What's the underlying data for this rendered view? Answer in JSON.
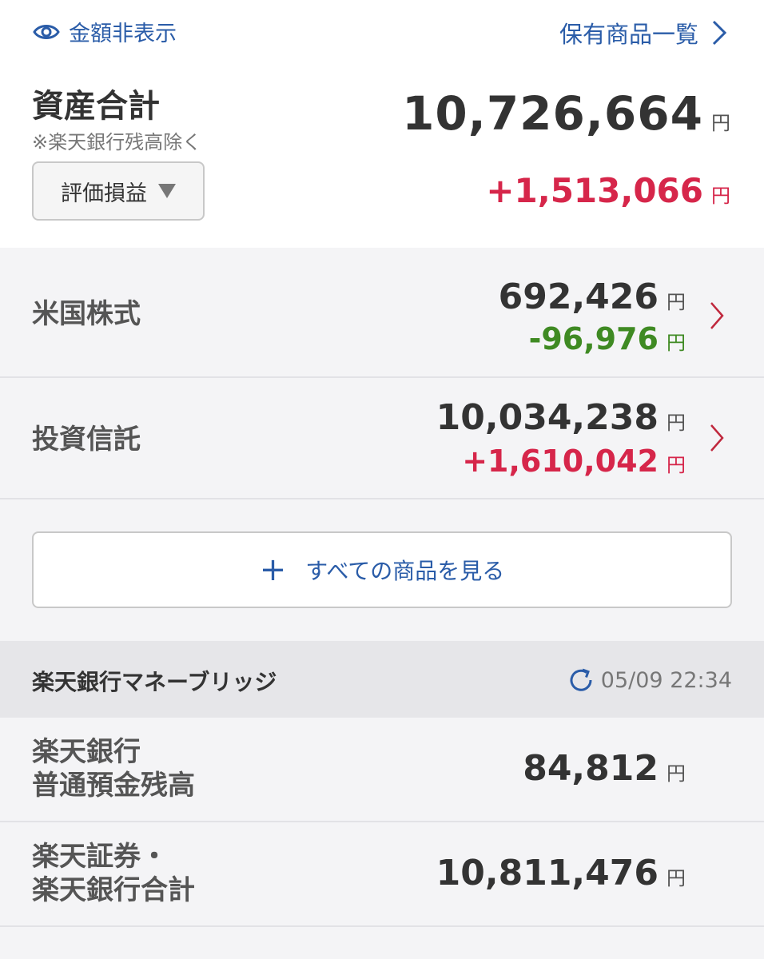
{
  "header": {
    "hide_amounts": "金額非表示",
    "holdings_list": "保有商品一覧"
  },
  "summary": {
    "title": "資産合計",
    "note": "※楽天銀行残高除く",
    "total": "10,726,664",
    "currency": "円",
    "pl_selector": "評価損益",
    "total_gain": "+1,513,066"
  },
  "holdings": [
    {
      "label": "米国株式",
      "value": "692,426",
      "change": "-96,976",
      "currency": "円"
    },
    {
      "label": "投資信託",
      "value": "10,034,238",
      "change": "+1,610,042",
      "currency": "円"
    }
  ],
  "view_all_button": "すべての商品を見る",
  "bridge": {
    "title": "楽天銀行マネーブリッジ",
    "updated": "05/09 22:34",
    "rows": [
      {
        "label_line1": "楽天銀行",
        "label_line2": "普通預金残高",
        "value": "84,812",
        "currency": "円"
      },
      {
        "label_line1": "楽天証券・",
        "label_line2": "楽天銀行合計",
        "value": "10,811,476",
        "currency": "円"
      }
    ]
  },
  "colors": {
    "accent": "#2a5ca8",
    "gain": "#d6264a",
    "loss": "#3f8a23"
  },
  "icons": {
    "eye": "eye-icon",
    "chevron": "chevron-right-icon",
    "refresh": "refresh-icon",
    "plus": "plus-icon"
  }
}
